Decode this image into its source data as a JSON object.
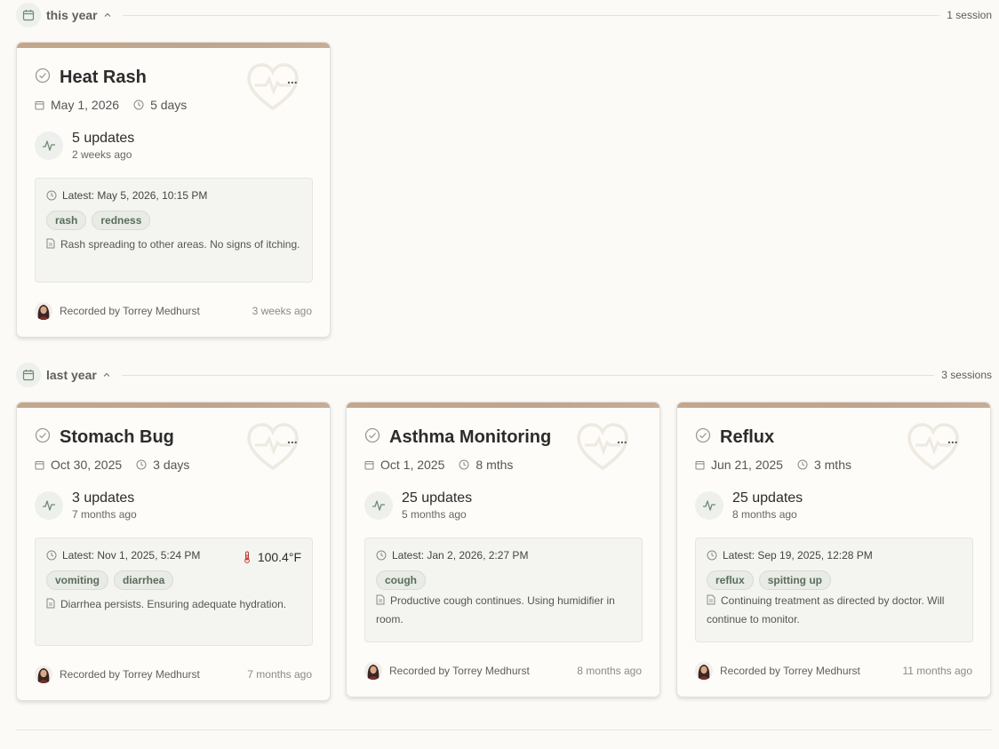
{
  "groups": [
    {
      "label": "this year",
      "count": "1 session",
      "sessions": [
        {
          "title": "Heat Rash",
          "date": "May 1, 2026",
          "duration": "5 days",
          "updates": "5 updates",
          "updates_ago": "2 weeks ago",
          "latest": "Latest: May 5, 2026, 10:15 PM",
          "temperature": "",
          "tags": [
            "rash",
            "redness"
          ],
          "note": "Rash spreading to other areas. No signs of itching.",
          "recorded_by": "Recorded by Torrey Medhurst",
          "recorded_ago": "3 weeks ago"
        }
      ]
    },
    {
      "label": "last year",
      "count": "3 sessions",
      "sessions": [
        {
          "title": "Stomach Bug",
          "date": "Oct 30, 2025",
          "duration": "3 days",
          "updates": "3 updates",
          "updates_ago": "7 months ago",
          "latest": "Latest: Nov 1, 2025, 5:24 PM",
          "temperature": "100.4°F",
          "tags": [
            "vomiting",
            "diarrhea"
          ],
          "note": "Diarrhea persists. Ensuring adequate hydration.",
          "recorded_by": "Recorded by Torrey Medhurst",
          "recorded_ago": "7 months ago"
        },
        {
          "title": "Asthma Monitoring",
          "date": "Oct 1, 2025",
          "duration": "8 mths",
          "updates": "25 updates",
          "updates_ago": "5 months ago",
          "latest": "Latest: Jan 2, 2026, 2:27 PM",
          "temperature": "",
          "tags": [
            "cough"
          ],
          "note": "Productive cough continues. Using humidifier in room.",
          "recorded_by": "Recorded by Torrey Medhurst",
          "recorded_ago": "8 months ago"
        },
        {
          "title": "Reflux",
          "date": "Jun 21, 2025",
          "duration": "3 mths",
          "updates": "25 updates",
          "updates_ago": "8 months ago",
          "latest": "Latest: Sep 19, 2025, 12:28 PM",
          "temperature": "",
          "tags": [
            "reflux",
            "spitting up"
          ],
          "note": "Continuing treatment as directed by doctor. Will continue to monitor.",
          "recorded_by": "Recorded by Torrey Medhurst",
          "recorded_ago": "11 months ago"
        }
      ]
    }
  ],
  "icons": {
    "group": "calendar-icon",
    "collapse": "chevron-up-icon",
    "status": "check-circle-icon",
    "watermark": "heart-pulse-icon",
    "menu": "more-icon",
    "date": "calendar-icon",
    "duration": "clock-icon",
    "updates": "activity-icon",
    "latest": "clock-icon",
    "temperature": "thermometer-icon",
    "note": "document-icon"
  },
  "colors": {
    "page_background": "#fbfaf7",
    "card_accent_bar": "#c3a78c",
    "tag_text": "#5a6e5a",
    "icon_tint": "#6f8a72",
    "thermometer": "#c0392b"
  }
}
